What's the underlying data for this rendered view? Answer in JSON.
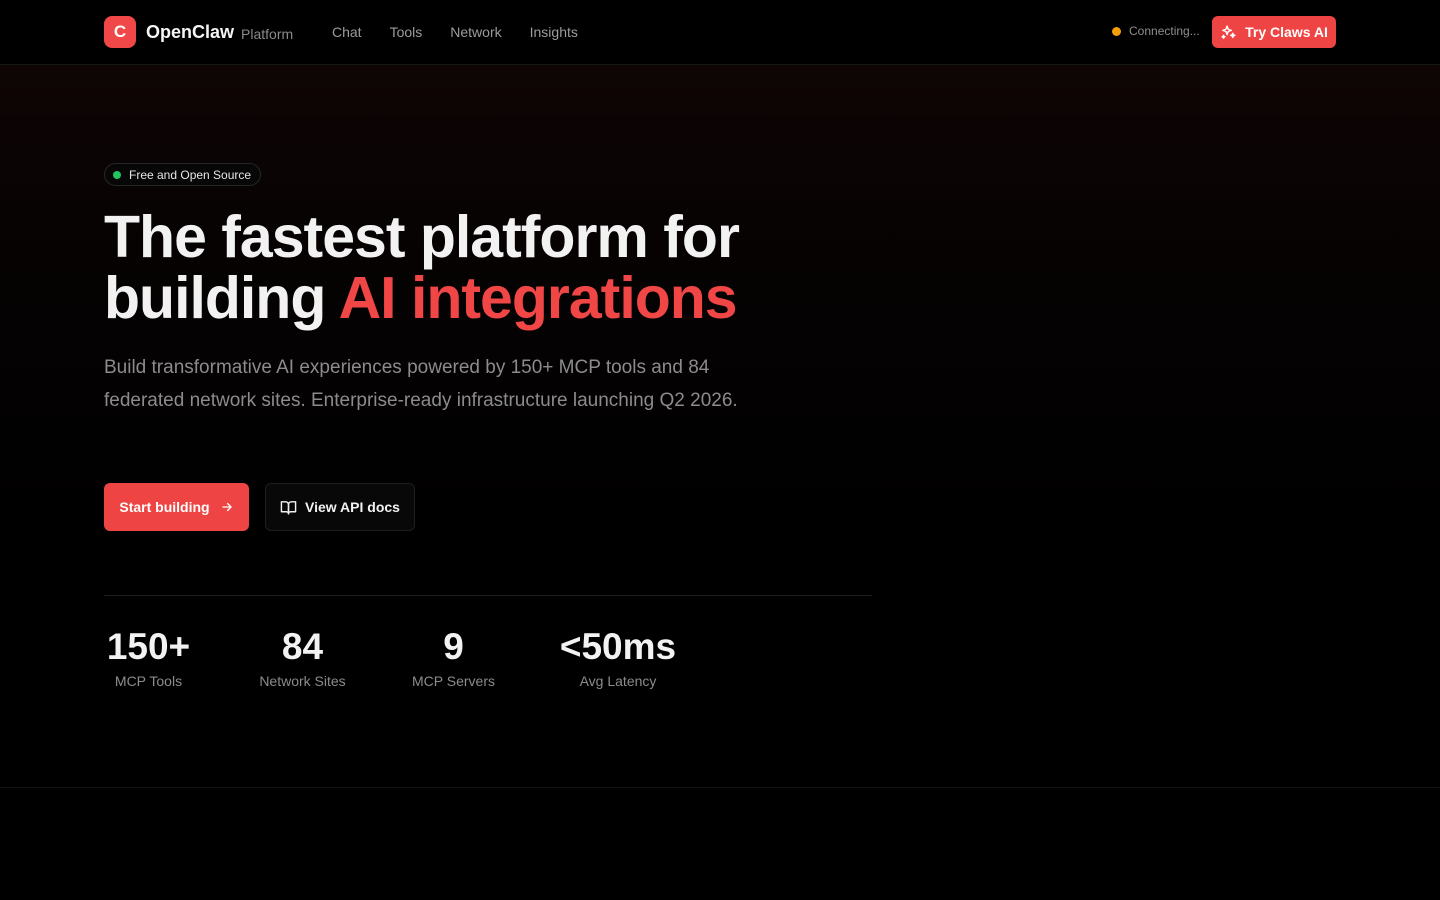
{
  "header": {
    "logo_letter": "C",
    "brand_name": "OpenClaw",
    "brand_sub": "Platform",
    "nav": [
      "Chat",
      "Tools",
      "Network",
      "Insights"
    ],
    "status_text": "Connecting...",
    "cta_label": "Try Claws AI",
    "cta_icon": "sparkles-icon"
  },
  "hero": {
    "badge": "Free and Open Source",
    "headline_line1": "The fastest platform for",
    "headline_line2_start": "building ",
    "headline_accent": "AI integrations",
    "subtitle": "Build transformative AI experiences powered by 150+ MCP tools and 84 federated network sites. Enterprise-ready infrastructure launching Q2 2026.",
    "primary_button": "Start building",
    "secondary_button": "View API docs"
  },
  "stats": [
    {
      "value": "150+",
      "label": "MCP Tools"
    },
    {
      "value": "84",
      "label": "Network Sites"
    },
    {
      "value": "9",
      "label": "MCP Servers"
    },
    {
      "value": "<50ms",
      "label": "Avg Latency"
    }
  ],
  "colors": {
    "accent": "#ef4444",
    "status_connecting": "#f59e0b",
    "badge_dot": "#22c55e",
    "background": "#000000"
  }
}
